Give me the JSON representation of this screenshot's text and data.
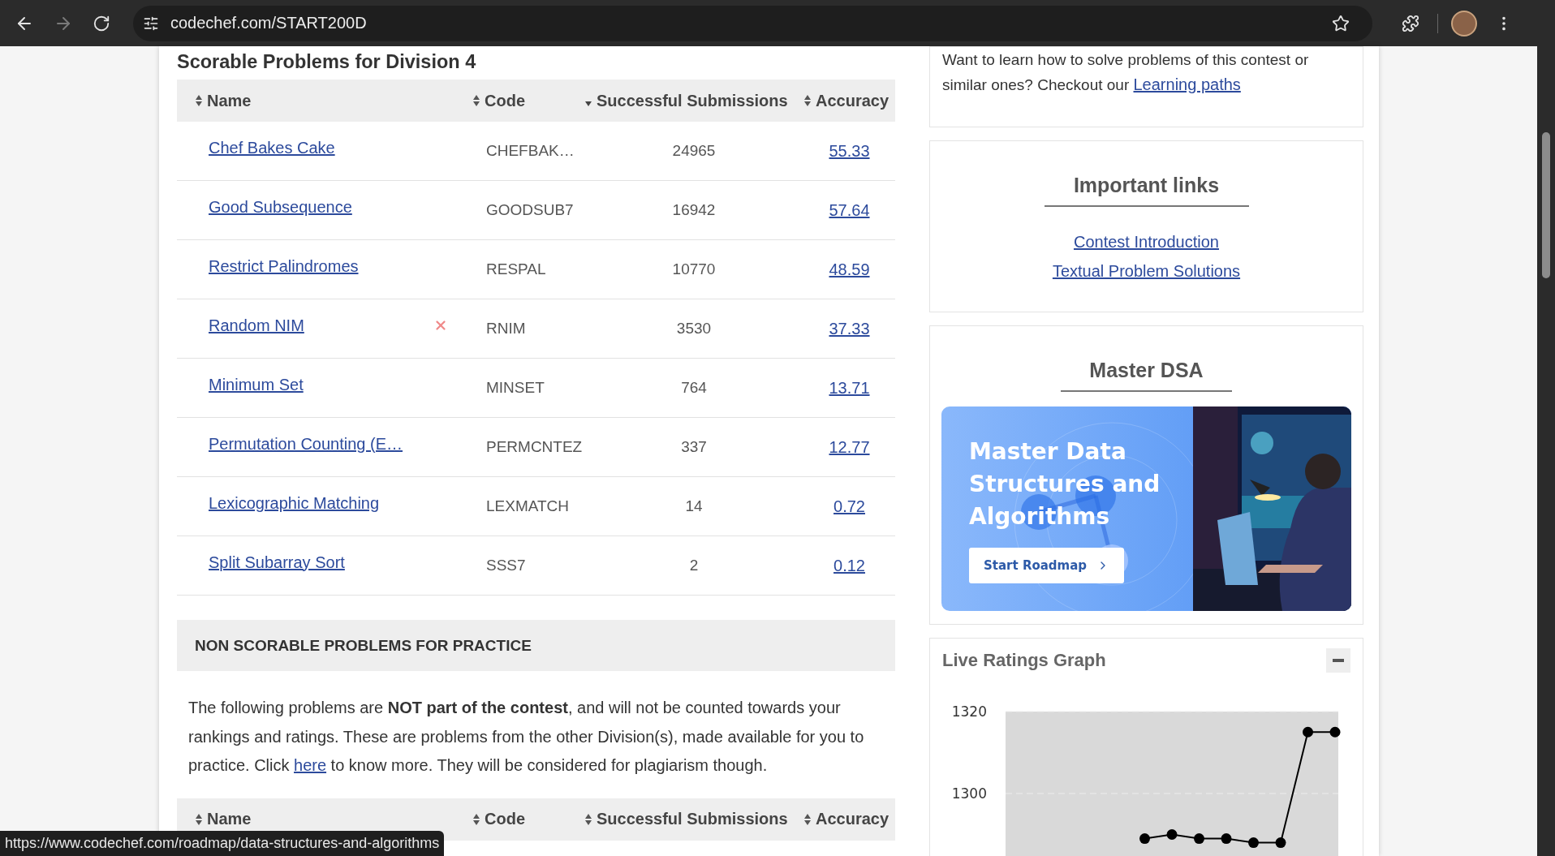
{
  "browser": {
    "url": "codechef.com/START200D"
  },
  "scorable": {
    "title": "Scorable Problems for Division 4",
    "columns": [
      {
        "label": "Name",
        "sorted": false
      },
      {
        "label": "Code",
        "sorted": false
      },
      {
        "label": "Successful Submissions",
        "sorted": true
      },
      {
        "label": "Accuracy",
        "sorted": false
      }
    ],
    "rows": [
      {
        "name": "Chef Bakes Cake",
        "wrong": false,
        "code": "CHEFBAK…",
        "submissions": "24965",
        "accuracy": "55.33"
      },
      {
        "name": "Good Subsequence",
        "wrong": false,
        "code": "GOODSUB7",
        "submissions": "16942",
        "accuracy": "57.64"
      },
      {
        "name": "Restrict Palindromes",
        "wrong": false,
        "code": "RESPAL",
        "submissions": "10770",
        "accuracy": "48.59"
      },
      {
        "name": "Random NIM",
        "wrong": true,
        "code": "RNIM",
        "submissions": "3530",
        "accuracy": "37.33"
      },
      {
        "name": "Minimum Set",
        "wrong": false,
        "code": "MINSET",
        "submissions": "764",
        "accuracy": "13.71"
      },
      {
        "name": "Permutation Counting (E…",
        "wrong": false,
        "code": "PERMCNTEZ",
        "submissions": "337",
        "accuracy": "12.77"
      },
      {
        "name": "Lexicographic Matching",
        "wrong": false,
        "code": "LEXMATCH",
        "submissions": "14",
        "accuracy": "0.72"
      },
      {
        "name": "Split Subarray Sort",
        "wrong": false,
        "code": "SSS7",
        "submissions": "2",
        "accuracy": "0.12"
      }
    ]
  },
  "non_scorable": {
    "title": "NON SCORABLE PROBLEMS FOR PRACTICE",
    "notice_before": "The following problems are **NOT part of the contest**, and will not be counted towards your rankings and ratings. These are problems from the other Division(s), made available for you to practice. Click ",
    "notice_link": "here",
    "notice_after": " to know more. They will be considered for plagiarism though.",
    "columns": [
      {
        "label": "Name",
        "sorted": false
      },
      {
        "label": "Code",
        "sorted": false
      },
      {
        "label": "Successful Submissions",
        "sorted": false
      },
      {
        "label": "Accuracy",
        "sorted": false
      }
    ]
  },
  "sidebar": {
    "learning": {
      "text": "Want to learn how to solve problems of this contest or similar ones? Checkout our ",
      "link": "Learning paths"
    },
    "important_links": {
      "title": "Important links",
      "links": [
        "Contest Introduction",
        "Textual Problem Solutions"
      ]
    },
    "master_dsa": {
      "title": "Master DSA",
      "banner": {
        "headline": "Master Data Structures and Algorithms",
        "button": "Start Roadmap"
      }
    },
    "ratings": {
      "title": "Live Ratings Graph",
      "chart_data": {
        "type": "line",
        "ylim": [
          1270,
          1320
        ],
        "yticks": [
          1300,
          1320
        ],
        "categories": [
          null,
          null,
          null,
          null,
          null,
          null,
          null,
          null,
          null,
          null,
          null,
          null,
          null
        ],
        "series": [
          {
            "color": "#000000",
            "marker": "circle",
            "values": [
              null,
              null,
              null,
              null,
              null,
              1289,
              1290,
              1289,
              1289,
              1288,
              1288,
              1315,
              1315
            ]
          }
        ]
      }
    }
  },
  "status_url": "https://www.codechef.com/roadmap/data-structures-and-algorithms"
}
